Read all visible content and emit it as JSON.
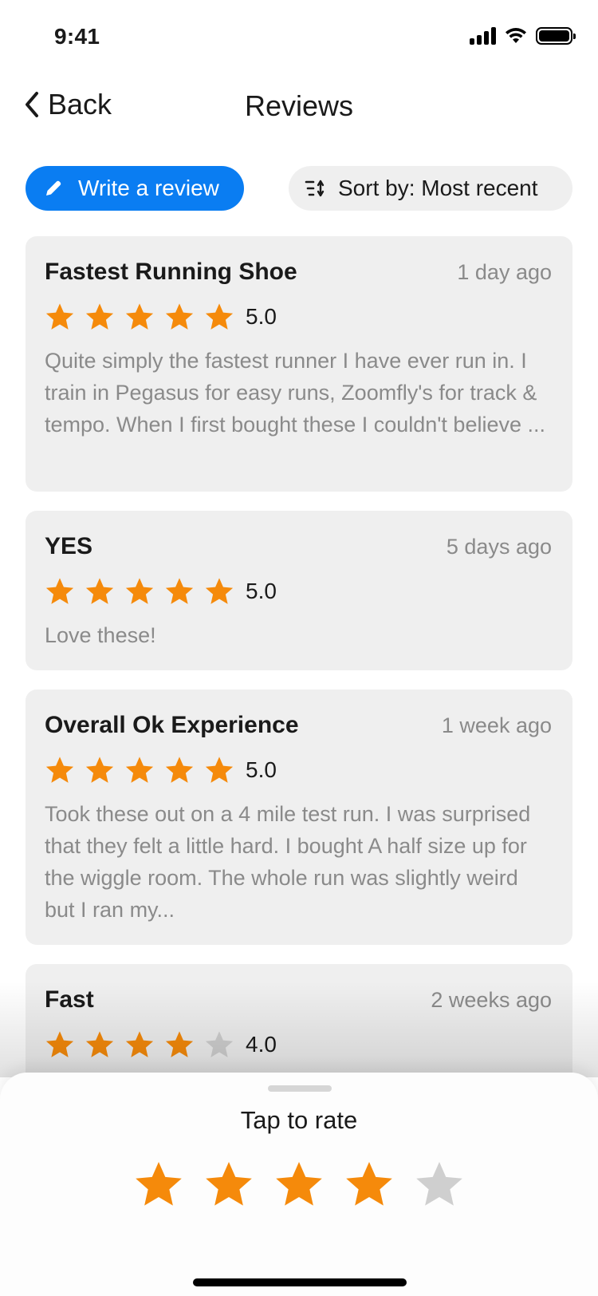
{
  "status_bar": {
    "time": "9:41"
  },
  "nav": {
    "back_label": "Back",
    "title": "Reviews"
  },
  "actions": {
    "write_label": "Write a review",
    "sort_label": "Sort by: Most recent"
  },
  "colors": {
    "accent": "#0a7df2",
    "star_filled": "#f58a0b",
    "star_empty": "#cfcfcf",
    "card_bg": "#efefef",
    "muted_text": "#8a8a8a"
  },
  "reviews": [
    {
      "title": "Fastest Running Shoe",
      "date": "1 day ago",
      "rating": 5,
      "rating_label": "5.0",
      "body": "Quite simply the fastest runner I have ever run in. I train in Pegasus for easy runs, Zoomfly's for track & tempo. When I first bought these I couldn't believe ..."
    },
    {
      "title": "YES",
      "date": "5 days ago",
      "rating": 5,
      "rating_label": "5.0",
      "body": "Love these!"
    },
    {
      "title": "Overall Ok Experience",
      "date": "1 week ago",
      "rating": 5,
      "rating_label": "5.0",
      "body": "Took these out on a 4 mile test run. I was surprised that they felt a little hard. I bought A half size up for the wiggle room. The whole run was slightly weird but I ran my..."
    },
    {
      "title": "Fast",
      "date": "2 weeks ago",
      "rating": 4,
      "rating_label": "4.0",
      "body": ""
    }
  ],
  "rate_sheet": {
    "title": "Tap to rate",
    "selected_rating": 4,
    "max_rating": 5
  },
  "icons": {
    "back": "chevron-left-icon",
    "write": "pencil-icon",
    "sort": "sort-icon",
    "star": "star-icon"
  }
}
